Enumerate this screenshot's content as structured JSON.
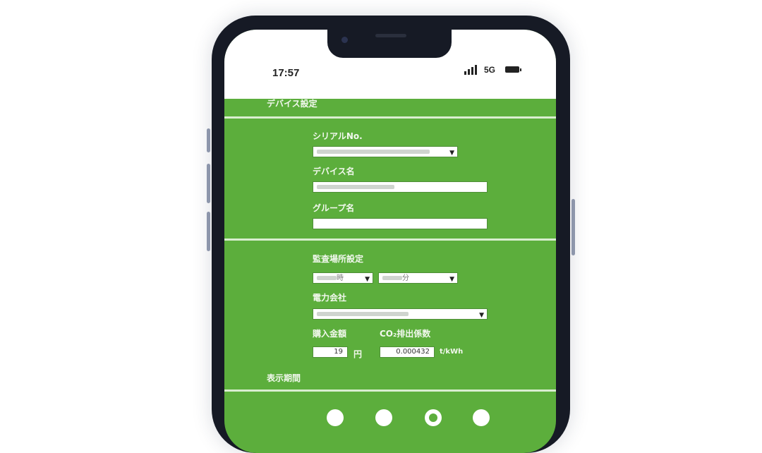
{
  "status": {
    "time": "17:57",
    "network": "5G"
  },
  "header": {
    "title": "デバイス設定"
  },
  "device": {
    "serial_label": "シリアルNo.",
    "device_name_label": "デバイス名",
    "group_name_label": "グループ名",
    "group_name_value": ""
  },
  "billing": {
    "period_label": "監査場所設定",
    "period_hour_suffix": "時",
    "period_min_suffix": "分",
    "company_label": "電力会社",
    "purchase_label": "購入金額",
    "co2_label": "CO₂排出係数",
    "purchase_value": "19",
    "purchase_unit": "円",
    "co2_value": "0.000432",
    "co2_unit": "t/kWh"
  },
  "display_period_label": "表示期間",
  "colors": {
    "screen_green": "#5cae3c",
    "frame": "#161a25",
    "separator": "#d9eecf"
  },
  "icons": {
    "dropdown": "chevron-down-icon"
  }
}
